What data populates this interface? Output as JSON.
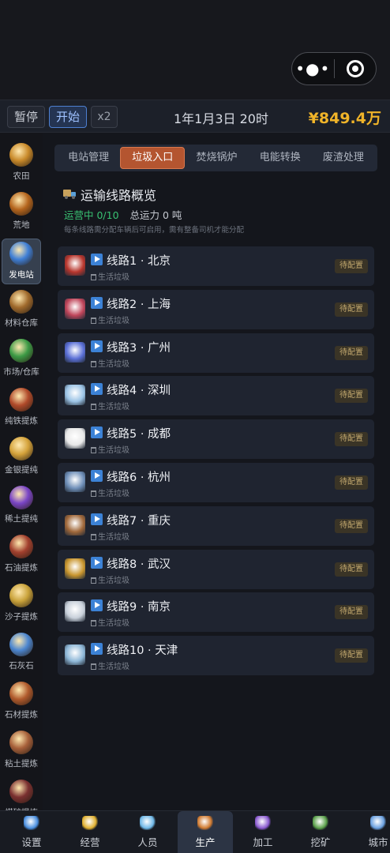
{
  "top_capsule": {
    "more_icon": "ellipsis-icon",
    "close_icon": "target-circle-icon"
  },
  "topbar": {
    "pause_label": "暂停",
    "start_label": "开始",
    "speed_label": "x2",
    "game_time": "1年1月3日 20时",
    "money": "¥849.4万"
  },
  "sidebar": {
    "items": [
      {
        "label": "农田",
        "icon": "farm-icon",
        "color": "#c98a2a"
      },
      {
        "label": "荒地",
        "icon": "wasteland-icon",
        "color": "#b5651d"
      },
      {
        "label": "发电站",
        "icon": "power-station-icon",
        "color": "#3f7fd6"
      },
      {
        "label": "材料仓库",
        "icon": "warehouse-icon",
        "color": "#a06a2c"
      },
      {
        "label": "市场/仓库",
        "icon": "market-icon",
        "color": "#3c9a45"
      },
      {
        "label": "纯铁提炼",
        "icon": "iron-refine-icon",
        "color": "#b04a2a"
      },
      {
        "label": "金银提纯",
        "icon": "gold-silver-icon",
        "color": "#d4a23a"
      },
      {
        "label": "稀土提纯",
        "icon": "rare-earth-icon",
        "color": "#7a45c6"
      },
      {
        "label": "石油提炼",
        "icon": "oil-refine-icon",
        "color": "#a2402e"
      },
      {
        "label": "沙子提炼",
        "icon": "sand-icon",
        "color": "#c9a23a"
      },
      {
        "label": "石灰石",
        "icon": "limestone-icon",
        "color": "#4b86d0"
      },
      {
        "label": "石材提炼",
        "icon": "stone-icon",
        "color": "#b05a2c"
      },
      {
        "label": "粘土提炼",
        "icon": "clay-icon",
        "color": "#a7603a"
      },
      {
        "label": "煤矿提炼",
        "icon": "coal-icon",
        "color": "#7a3030"
      }
    ]
  },
  "tabs": [
    "电站管理",
    "垃圾入口",
    "焚烧锅炉",
    "电能转换",
    "废渣处理"
  ],
  "overview": {
    "title": "运输线路概览",
    "running": "运营中 0/10",
    "capacity": "总运力 0 吨",
    "hint": "每条线路需分配车辆后可启用，需有整备司机才能分配"
  },
  "routes": [
    {
      "name": "线路1 · 北京",
      "cargo": "生活垃圾",
      "status": "待配置",
      "icon": "tiananmen-icon",
      "color": "#b8362d"
    },
    {
      "name": "线路2 · 上海",
      "cargo": "生活垃圾",
      "status": "待配置",
      "icon": "pearl-tower-icon",
      "color": "#c0455a"
    },
    {
      "name": "线路3 · 广州",
      "cargo": "生活垃圾",
      "status": "待配置",
      "icon": "canton-tower-icon",
      "color": "#5a6fd6"
    },
    {
      "name": "线路4 · 深圳",
      "cargo": "生活垃圾",
      "status": "待配置",
      "icon": "skyscraper-icon",
      "color": "#9cc4e6"
    },
    {
      "name": "线路5 · 成都",
      "cargo": "生活垃圾",
      "status": "待配置",
      "icon": "panda-icon",
      "color": "#e8e8e8"
    },
    {
      "name": "线路6 · 杭州",
      "cargo": "生活垃圾",
      "status": "待配置",
      "icon": "hangzhou-building-icon",
      "color": "#6f8fb8"
    },
    {
      "name": "线路7 · 重庆",
      "cargo": "生活垃圾",
      "status": "待配置",
      "icon": "hongyadong-icon",
      "color": "#a0683a"
    },
    {
      "name": "线路8 · 武汉",
      "cargo": "生活垃圾",
      "status": "待配置",
      "icon": "yellow-crane-tower-icon",
      "color": "#c9962e"
    },
    {
      "name": "线路9 · 南京",
      "cargo": "生活垃圾",
      "status": "待配置",
      "icon": "nanjing-building-icon",
      "color": "#c8d0da"
    },
    {
      "name": "线路10 · 天津",
      "cargo": "生活垃圾",
      "status": "待配置",
      "icon": "tianjin-building-icon",
      "color": "#8fb8d8"
    }
  ],
  "bottom_nav": [
    {
      "label": "设置",
      "icon": "gear-icon",
      "color": "#4a8fe0"
    },
    {
      "label": "经营",
      "icon": "business-icon",
      "color": "#e0b030"
    },
    {
      "label": "人员",
      "icon": "people-icon",
      "color": "#6fb8e8"
    },
    {
      "label": "生产",
      "icon": "factory-icon",
      "color": "#d07a30"
    },
    {
      "label": "加工",
      "icon": "processing-icon",
      "color": "#8a5ad0"
    },
    {
      "label": "挖矿",
      "icon": "mining-icon",
      "color": "#5aa04a"
    },
    {
      "label": "城市",
      "icon": "city-icon",
      "color": "#6aa0e0"
    }
  ]
}
